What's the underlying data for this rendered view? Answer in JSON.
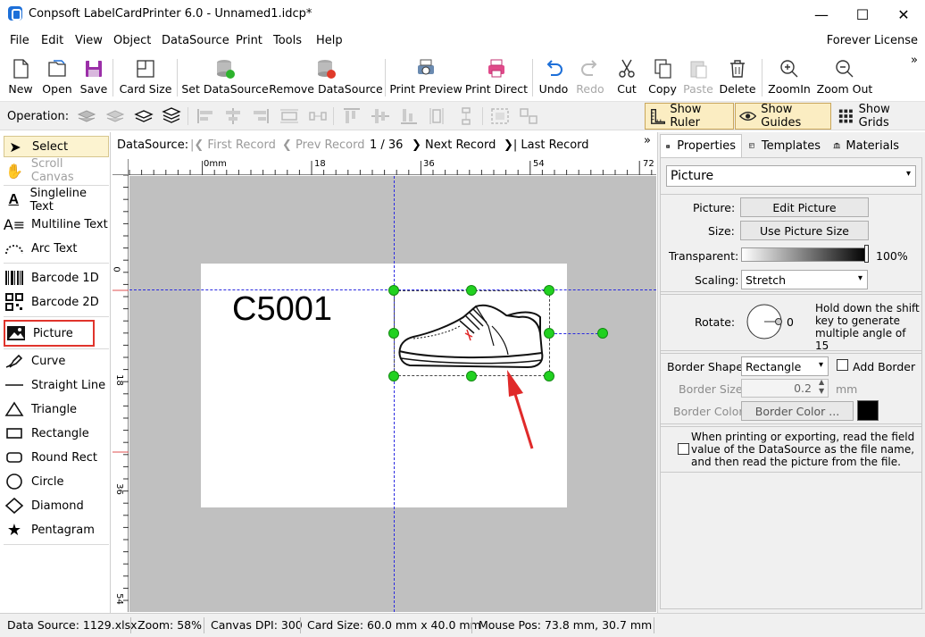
{
  "window": {
    "title": "Conpsoft LabelCardPrinter 6.0 - Unnamed1.idcp*",
    "minimize": "—",
    "maximize": "☐",
    "close": "✕"
  },
  "menu": {
    "items": [
      "File",
      "Edit",
      "View",
      "Object",
      "DataSource",
      "Print",
      "Tools",
      "Help"
    ],
    "license": "Forever License"
  },
  "toolbar": {
    "new": "New",
    "open": "Open",
    "save": "Save",
    "card_size": "Card Size",
    "set_datasource": "Set DataSource",
    "remove_datasource": "Remove DataSource",
    "print_preview": "Print Preview",
    "print_direct": "Print Direct",
    "undo": "Undo",
    "redo": "Redo",
    "cut": "Cut",
    "copy": "Copy",
    "paste": "Paste",
    "delete": "Delete",
    "zoom_in": "ZoomIn",
    "zoom_out": "Zoom Out",
    "overflow": "»"
  },
  "operation": {
    "label": "Operation:",
    "show_ruler": "Show Ruler",
    "show_guides": "Show Guides",
    "show_grids": "Show Grids"
  },
  "tools": {
    "select": "Select",
    "scroll_canvas": "Scroll Canvas",
    "singleline_text": "Singleline Text",
    "multiline_text": "Multiline Text",
    "arc_text": "Arc Text",
    "barcode_1d": "Barcode 1D",
    "barcode_2d": "Barcode 2D",
    "picture": "Picture",
    "curve": "Curve",
    "straight_line": "Straight Line",
    "triangle": "Triangle",
    "rectangle": "Rectangle",
    "round_rect": "Round Rect",
    "circle": "Circle",
    "diamond": "Diamond",
    "pentagram": "Pentagram"
  },
  "datasource_bar": {
    "label": "DataSource:",
    "first": "First Record",
    "prev": "Prev Record",
    "position": "1 / 36",
    "next": "Next Record",
    "last": "Last Record",
    "overflow": "»"
  },
  "ruler": {
    "h_ticks": [
      "0mm",
      "18",
      "36",
      "54",
      "72"
    ],
    "v_ticks": [
      "0",
      "18",
      "36",
      "54"
    ]
  },
  "card": {
    "text": "C5001"
  },
  "panel": {
    "tabs": [
      "Properties",
      "Templates",
      "Materials"
    ],
    "object_type": "Picture",
    "picture_label": "Picture:",
    "edit_picture": "Edit Picture",
    "size_label": "Size:",
    "use_picture_size": "Use Picture Size",
    "transparent_label": "Transparent:",
    "transparent_value": "100%",
    "scaling_label": "Scaling:",
    "scaling_value": "Stretch",
    "rotate_label": "Rotate:",
    "rotate_value": "0",
    "rotate_hint": "Hold down the shift key to generate multiple angle of 15",
    "border_shape_label": "Border Shape:",
    "border_shape_value": "Rectangle",
    "add_border": "Add Border",
    "border_size_label": "Border Size:",
    "border_size_value": "0.2",
    "border_size_unit": "mm",
    "border_color_label": "Border Color:",
    "border_color_button": "Border Color ...",
    "border_color": "#000000",
    "datasource_note": "When printing or exporting, read the field value of the DataSource as the file name, and then read the picture from the file."
  },
  "status": {
    "datasource": "Data Source: 1129.xlsx",
    "zoom": "Zoom: 58%",
    "dpi": "Canvas DPI: 300",
    "card_size": "Card Size: 60.0 mm x 40.0 mm",
    "mouse": "Mouse Pos: 73.8 mm, 30.7 mm"
  },
  "colors": {
    "accent": "#1d6fd8",
    "selection_handle": "#21d120",
    "guide": "#2a2ae0",
    "highlight_box": "#e0342c",
    "arrow": "#e02a2a"
  }
}
